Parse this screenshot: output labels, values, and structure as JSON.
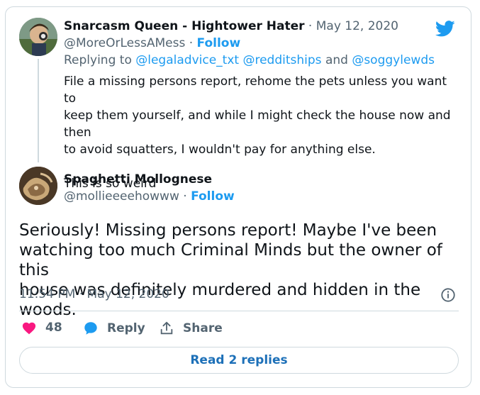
{
  "reply_tweet": {
    "display_name": "Snarcasm Queen - Hightower Hater",
    "date": "May 12, 2020",
    "handle": "@MoreOrLessAMess",
    "follow_label": "Follow",
    "replying_to_prefix": "Replying to",
    "replying_to_users": [
      "@legaladvice_txt",
      "@redditships",
      "@soggylewds"
    ],
    "replying_to_conj": "and",
    "body_lines": [
      "File a missing persons report, rehome the pets unless you want to",
      "keep them yourself, and while I might check the house now and then",
      "to avoid squatters, I wouldn't pay for anything else.",
      "This is so weird"
    ]
  },
  "main_tweet": {
    "display_name": "Spaghetti Mollognese",
    "handle": "@mollieeeehowww",
    "follow_label": "Follow",
    "body_lines": [
      "Seriously! Missing persons report! Maybe I've been",
      "watching too much Criminal Minds but the owner of this",
      "house was definitely murdered and hidden in the woods."
    ],
    "timestamp": "11:54 PM · May 12, 2020"
  },
  "actions": {
    "like_count": "48",
    "reply_label": "Reply",
    "share_label": "Share"
  },
  "read_replies_label": "Read 2 replies",
  "colors": {
    "accent": "#1d9bf0",
    "like": "#f91880",
    "muted": "#536471",
    "border": "#cfd9de"
  },
  "icons": [
    "twitter-bird-icon",
    "info-icon",
    "heart-icon",
    "speech-bubble-icon",
    "share-icon"
  ]
}
